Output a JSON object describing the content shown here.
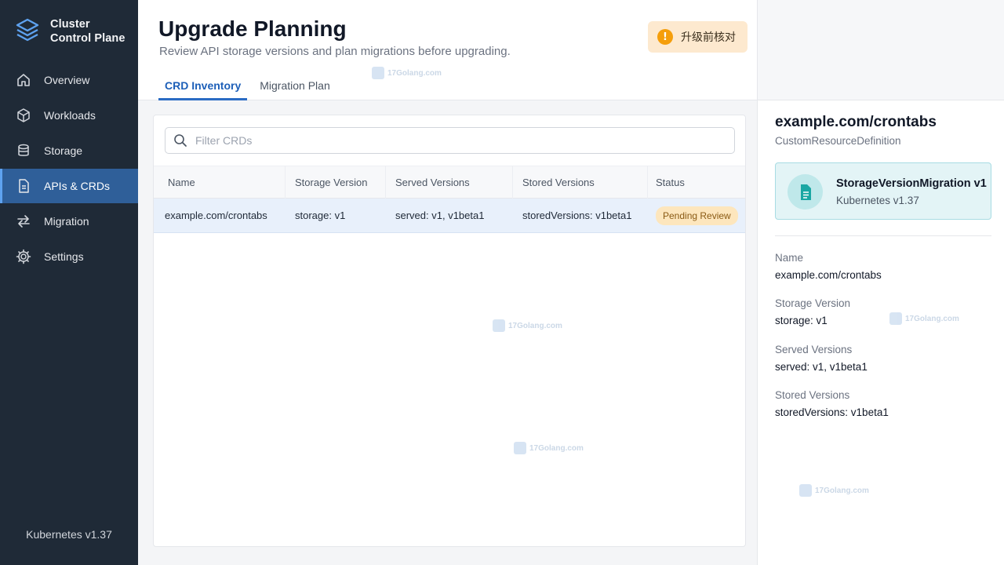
{
  "brand": {
    "line1": "Cluster",
    "line2": "Control Plane"
  },
  "nav": [
    {
      "label": "Overview",
      "icon": "home-icon",
      "active": false
    },
    {
      "label": "Workloads",
      "icon": "cube-icon",
      "active": false
    },
    {
      "label": "Storage",
      "icon": "database-icon",
      "active": false
    },
    {
      "label": "APIs & CRDs",
      "icon": "document-icon",
      "active": true
    },
    {
      "label": "Migration",
      "icon": "arrows-icon",
      "active": false
    },
    {
      "label": "Settings",
      "icon": "gear-icon",
      "active": false
    }
  ],
  "sidebar_footer": "Kubernetes v1.37",
  "header": {
    "title": "Upgrade Planning",
    "subtitle": "Review API storage versions and plan migrations before upgrading.",
    "notice": "升级前核对",
    "notice_icon": "!"
  },
  "tabs": [
    {
      "label": "CRD Inventory",
      "active": true
    },
    {
      "label": "Migration Plan",
      "active": false
    }
  ],
  "filter": {
    "placeholder": "Filter CRDs",
    "value": ""
  },
  "table": {
    "columns": [
      "Name",
      "Storage Version",
      "Served Versions",
      "Stored Versions",
      "Status"
    ],
    "rows": [
      {
        "name": "example.com/crontabs",
        "storage": "storage: v1",
        "served": "served: v1, v1beta1",
        "stored": "storedVersions: v1beta1",
        "status": "Pending Review"
      }
    ]
  },
  "detail": {
    "title": "example.com/crontabs",
    "subtitle": "CustomResourceDefinition",
    "card_title": "StorageVersionMigration v1",
    "card_sub": "Kubernetes v1.37",
    "fields": [
      {
        "label": "Name",
        "value": "example.com/crontabs"
      },
      {
        "label": "Storage Version",
        "value": "storage: v1"
      },
      {
        "label": "Served Versions",
        "value": "served: v1, v1beta1"
      },
      {
        "label": "Stored Versions",
        "value": "storedVersions: v1beta1"
      }
    ]
  },
  "watermark": "17Golang.com",
  "colors": {
    "sidebar_bg": "#1f2a37",
    "active_nav": "#2f5f99",
    "accent": "#2b6cc4",
    "badge_bg": "#fde6bd",
    "notice_bg": "#fde9cf",
    "card_bg": "#e3f4f6"
  }
}
